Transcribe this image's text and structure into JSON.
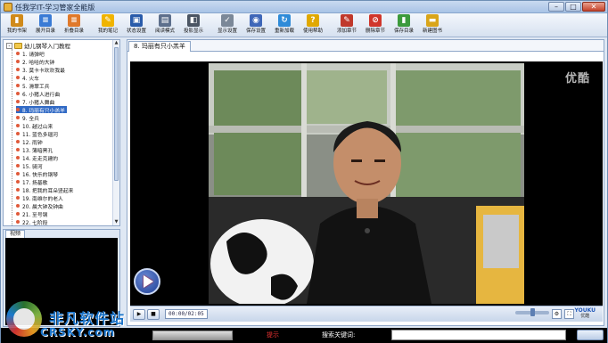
{
  "window": {
    "title": "任我学IT-学习管家全能版",
    "buttons": {
      "minimize": "–",
      "maximize": "□",
      "close": "✕"
    }
  },
  "toolbar": {
    "items": [
      {
        "label": "我的书架",
        "icon": "bookshelf-icon",
        "color": "#d08a1a",
        "glyph": "▮"
      },
      {
        "label": "展开目录",
        "icon": "expand-catalog-icon",
        "color": "#3a7bd5",
        "glyph": "≡"
      },
      {
        "label": "折叠目录",
        "icon": "collapse-catalog-icon",
        "color": "#e0792a",
        "glyph": "≡"
      },
      {
        "label": "我的笔记",
        "icon": "notes-icon",
        "color": "#f0b400",
        "glyph": "✎"
      },
      {
        "label": "状态设置",
        "icon": "status-settings-icon",
        "color": "#2a5caa",
        "glyph": "▣"
      },
      {
        "label": "阅读模式",
        "icon": "reading-mode-icon",
        "color": "#5d6f8c",
        "glyph": "▤"
      },
      {
        "label": "投影显示",
        "icon": "projector-icon",
        "color": "#4b5563",
        "glyph": "◧"
      },
      {
        "label": "显示设置",
        "icon": "display-settings-icon",
        "color": "#7b8898",
        "glyph": "✓"
      },
      {
        "label": "保存设置",
        "icon": "save-settings-icon",
        "color": "#3f67b8",
        "glyph": "◉"
      },
      {
        "label": "重新加载",
        "icon": "reload-icon",
        "color": "#2f8bd8",
        "glyph": "↻"
      },
      {
        "label": "使用帮助",
        "icon": "help-icon",
        "color": "#e0a800",
        "glyph": "?"
      },
      {
        "label": "添加章节",
        "icon": "add-chapter-icon",
        "color": "#c0392b",
        "glyph": "✎"
      },
      {
        "label": "删除章节",
        "icon": "delete-chapter-icon",
        "color": "#d0362b",
        "glyph": "⊘"
      },
      {
        "label": "保存目录",
        "icon": "save-catalog-icon",
        "color": "#3c9a3c",
        "glyph": "▮"
      },
      {
        "label": "新建图书",
        "icon": "new-book-icon",
        "color": "#d9a51a",
        "glyph": "▬"
      }
    ]
  },
  "tree": {
    "root": "幼儿钢琴入门教程",
    "selected_index": 7,
    "items": [
      "1. 请弹吧",
      "2. 哈哈的大钟",
      "3. 莫卡卡欢欢我最",
      "4. 火车",
      "5. 滑翠工兵",
      "6. 小猪人进行曲",
      "7. 小猪人舞曲",
      "8. 玛丽有只小羔羊",
      "9. 全兵",
      "10. 越过山来",
      "11. 蓝色多瑙河",
      "12. 雨钟",
      "13. 薄暗黑孔",
      "14. 走走克建的",
      "15. 骑河",
      "16. 快乐的钢琴",
      "17. 扬基歌",
      "18. 把我的耳朵竖起来",
      "19. 南维尔的老人",
      "20. 晨大钟及钟曲",
      "21. 至号钢",
      "22. 七阶段"
    ]
  },
  "video_panel": {
    "tab": "视频"
  },
  "main": {
    "tab": "8. 玛丽有只小羔羊",
    "watermark": "优酷",
    "time": "00:00/02:05",
    "volume": 0.5,
    "youku_logo": "YOUKU",
    "youku_sub": "优酷"
  },
  "statusbar": {
    "tip": "提示",
    "search_label": "搜索关键词:",
    "search_value": ""
  },
  "brand": {
    "name": "非凡软件站",
    "domain": "CRSKY.com"
  }
}
